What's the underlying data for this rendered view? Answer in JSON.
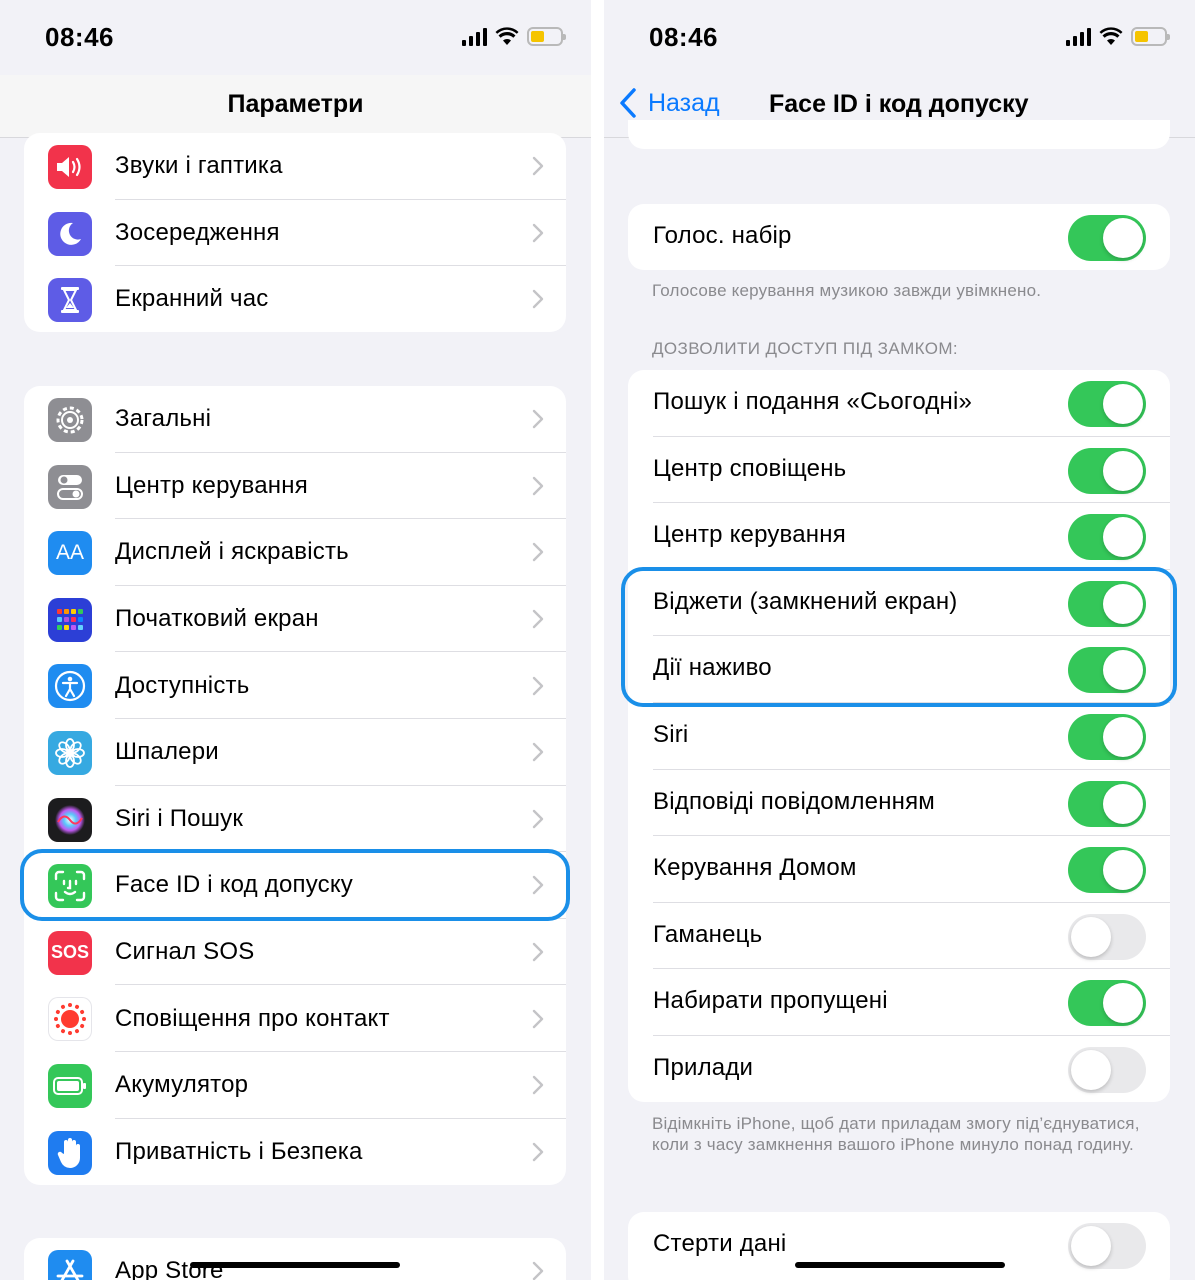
{
  "left": {
    "status_time": "08:46",
    "nav_title": "Параметри",
    "group1": [
      {
        "label": "Звуки і гаптика",
        "icon": "speaker-icon",
        "color": "#f2334b"
      },
      {
        "label": "Зосередження",
        "icon": "moon-icon",
        "color": "#5e5ce6"
      },
      {
        "label": "Екранний час",
        "icon": "hourglass-icon",
        "color": "#5e5ce6"
      }
    ],
    "group2": [
      {
        "label": "Загальні",
        "icon": "gear-icon",
        "color": "#8e8e93"
      },
      {
        "label": "Центр керування",
        "icon": "switches-icon",
        "color": "#8e8e93"
      },
      {
        "label": "Дисплей і яскравість",
        "icon": "text-size-icon",
        "color": "#1f8cf0",
        "icon_text": "AA"
      },
      {
        "label": "Початковий екран",
        "icon": "home-grid-icon",
        "color": "#2c3fd6"
      },
      {
        "label": "Доступність",
        "icon": "accessibility-icon",
        "color": "#1f8cf0"
      },
      {
        "label": "Шпалери",
        "icon": "flower-icon",
        "color": "#36a9e1"
      },
      {
        "label": "Siri і Пошук",
        "icon": "siri-icon",
        "color": "#1c1c1e"
      },
      {
        "label": "Face ID і код допуску",
        "icon": "face-id-icon",
        "color": "#34c759"
      },
      {
        "label": "Сигнал SOS",
        "icon": "sos-icon",
        "color": "#f2334b",
        "icon_text": "SOS"
      },
      {
        "label": "Сповіщення про контакт",
        "icon": "exposure-icon",
        "color": "#ffffff"
      },
      {
        "label": "Акумулятор",
        "icon": "battery-icon",
        "color": "#34c759"
      },
      {
        "label": "Приватність і Безпека",
        "icon": "hand-icon",
        "color": "#1f7cf0"
      }
    ],
    "group3": [
      {
        "label": "App Store",
        "icon": "app-store-icon",
        "color": "#1f8cf0"
      }
    ]
  },
  "right": {
    "status_time": "08:46",
    "back_label": "Назад",
    "nav_title": "Face ID і код допуску",
    "voice_dial": {
      "label": "Голос. набір",
      "on": true
    },
    "voice_footnote": "Голосове керування музикою завжди увімкнено.",
    "lock_header": "ДОЗВОЛИТИ ДОСТУП ПІД ЗАМКОМ:",
    "lock_items": [
      {
        "label": "Пошук і подання «Сьогодні»",
        "on": true
      },
      {
        "label": "Центр сповіщень",
        "on": true
      },
      {
        "label": "Центр керування",
        "on": true
      },
      {
        "label": "Віджети (замкнений екран)",
        "on": true
      },
      {
        "label": "Дії наживо",
        "on": true
      },
      {
        "label": "Siri",
        "on": true
      },
      {
        "label": "Відповіді повідомленням",
        "on": true
      },
      {
        "label": "Керування Домом",
        "on": true
      },
      {
        "label": "Гаманець",
        "on": false
      },
      {
        "label": "Набирати пропущені",
        "on": true
      },
      {
        "label": "Прилади",
        "on": false
      }
    ],
    "accessories_footnote": "Відімкніть iPhone, щоб дати приладам змогу під’єднуватися, коли з часу замкнення вашого iPhone минуло понад годину.",
    "erase": {
      "label": "Стерти дані",
      "on": false
    }
  },
  "colors": {
    "accent": "#0a7aff",
    "toggle_on": "#34c759",
    "highlight": "#1a8fe8"
  }
}
